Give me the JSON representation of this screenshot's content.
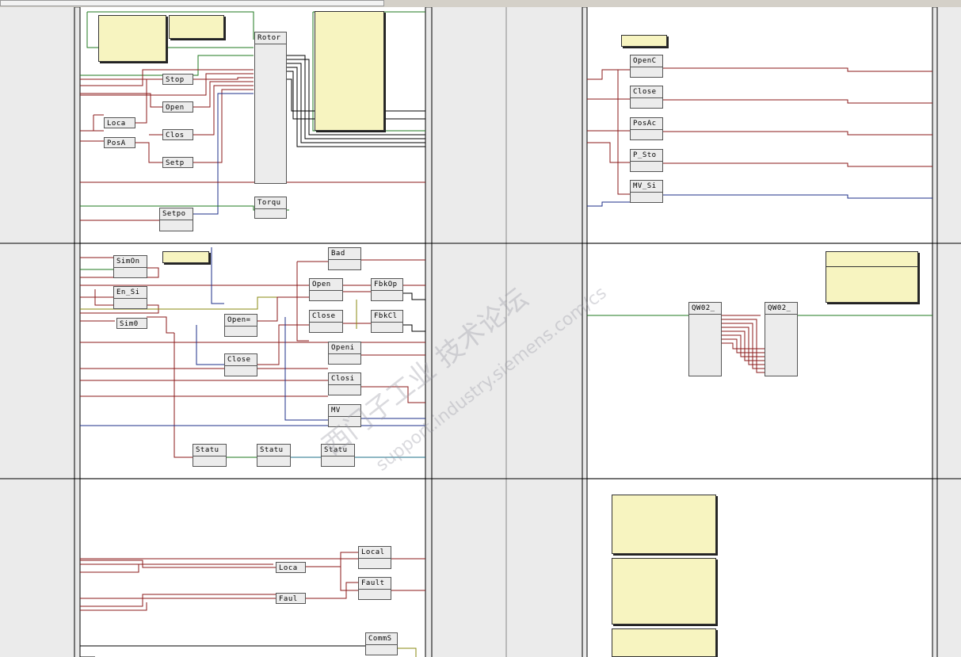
{
  "colors": {
    "wire_red": "#8b1a1a",
    "wire_green": "#1f7a1f",
    "wire_blue": "#1c2f8a",
    "wire_olive": "#8a8a10",
    "wire_teal": "#1f6f8a",
    "note_fill": "#f7f4c0",
    "block_fill": "#ececec"
  },
  "blocks": {
    "rotor": "Rotor",
    "torqu": "Torqu",
    "stop": "Stop",
    "open": "Open",
    "clos": "Clos",
    "setp": "Setp",
    "setpo": "Setpo",
    "loca_top": "Loca",
    "posa": "PosA",
    "simon": "SimOn",
    "en_si": "En_Si",
    "sim0": "Sim0",
    "open_eq": "Open=",
    "close_mid": "Close",
    "bad": "Bad",
    "open2": "Open",
    "close2": "Close",
    "fbkop": "FbkOp",
    "fbkcl": "FbkCl",
    "openi": "Openi",
    "closi": "Closi",
    "mv": "MV",
    "statu1": "Statu",
    "statu2": "Statu",
    "statu3": "Statu",
    "local": "Local",
    "loca_bot": "Loca",
    "fault": "Fault",
    "faul": "Faul",
    "comms": "CommS",
    "openc": "OpenC",
    "close_r": "Close",
    "posac": "PosAc",
    "psto": "P_Sto",
    "mvsi": "MV_Si",
    "qw02a": "QW02_",
    "qw02b": "QW02_"
  },
  "watermark": {
    "line1": "西门子工业  技术论坛",
    "line2": "support.industry.siemens.com/cs"
  }
}
